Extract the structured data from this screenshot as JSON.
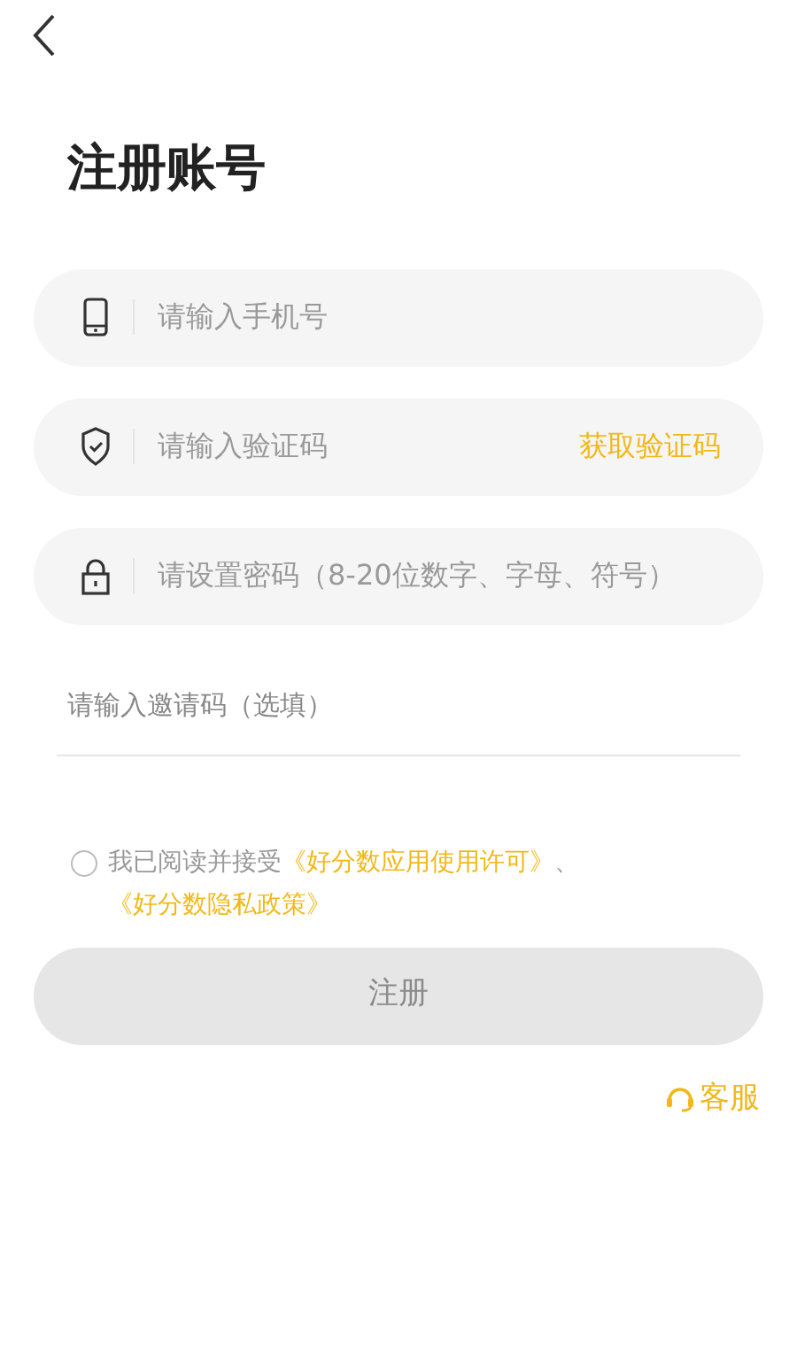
{
  "header": {
    "title": "注册账号"
  },
  "fields": [
    {
      "kind": "phone",
      "placeholder": "请输入手机号"
    },
    {
      "kind": "code",
      "placeholder": "请输入验证码",
      "action": "获取验证码"
    },
    {
      "kind": "password",
      "placeholder": "请设置密码（8-20位数字、字母、符号）"
    },
    {
      "kind": "invite",
      "placeholder": "请输入邀请码（选填）"
    }
  ],
  "agreement": {
    "checked": false,
    "text": "我已阅读并接受",
    "links": [
      "《好分数应用使用许可》",
      "《好分数隐私政策》"
    ],
    "separator": "、"
  },
  "register_button": {
    "label": "注册",
    "disabled": true
  },
  "support": {
    "label": "客服"
  }
}
